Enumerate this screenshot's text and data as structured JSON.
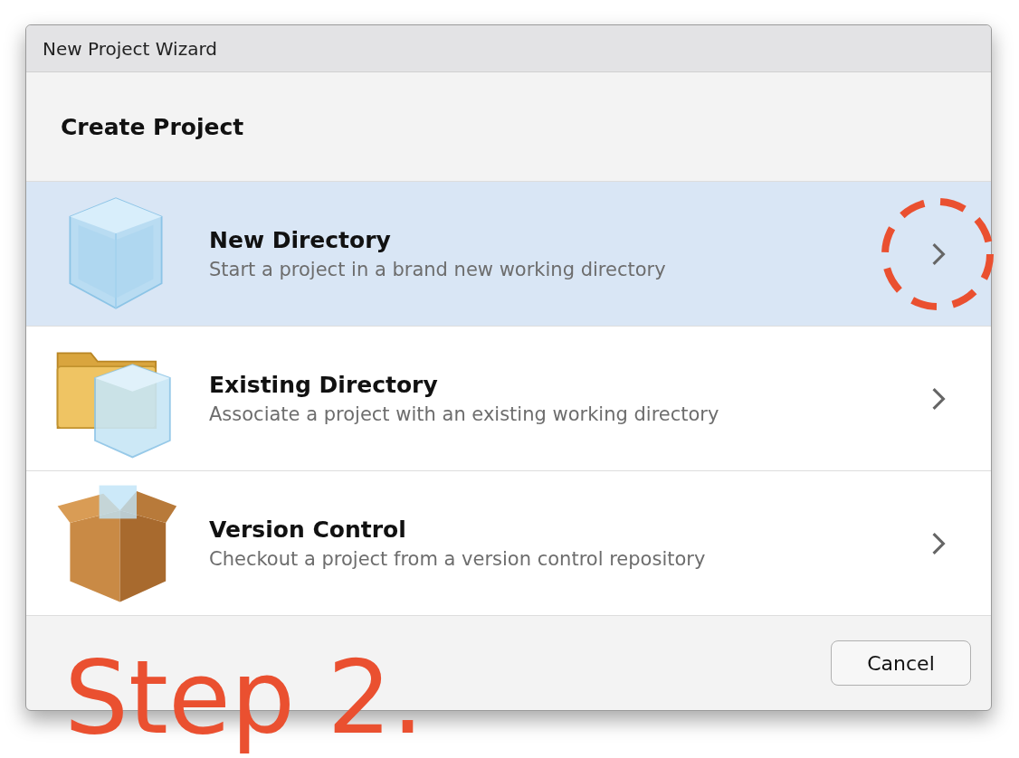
{
  "window": {
    "title": "New Project Wizard"
  },
  "heading": "Create Project",
  "options": [
    {
      "kind": "new",
      "title": "New Directory",
      "description": "Start a project in a brand new working directory",
      "selected": true,
      "circled": true
    },
    {
      "kind": "existing",
      "title": "Existing Directory",
      "description": "Associate a project with an existing working directory",
      "selected": false,
      "circled": false
    },
    {
      "kind": "vcs",
      "title": "Version Control",
      "description": "Checkout a project from a version control repository",
      "selected": false,
      "circled": false
    }
  ],
  "buttons": [
    {
      "label": "Cancel"
    }
  ],
  "annotation": {
    "text": "Step 2."
  }
}
